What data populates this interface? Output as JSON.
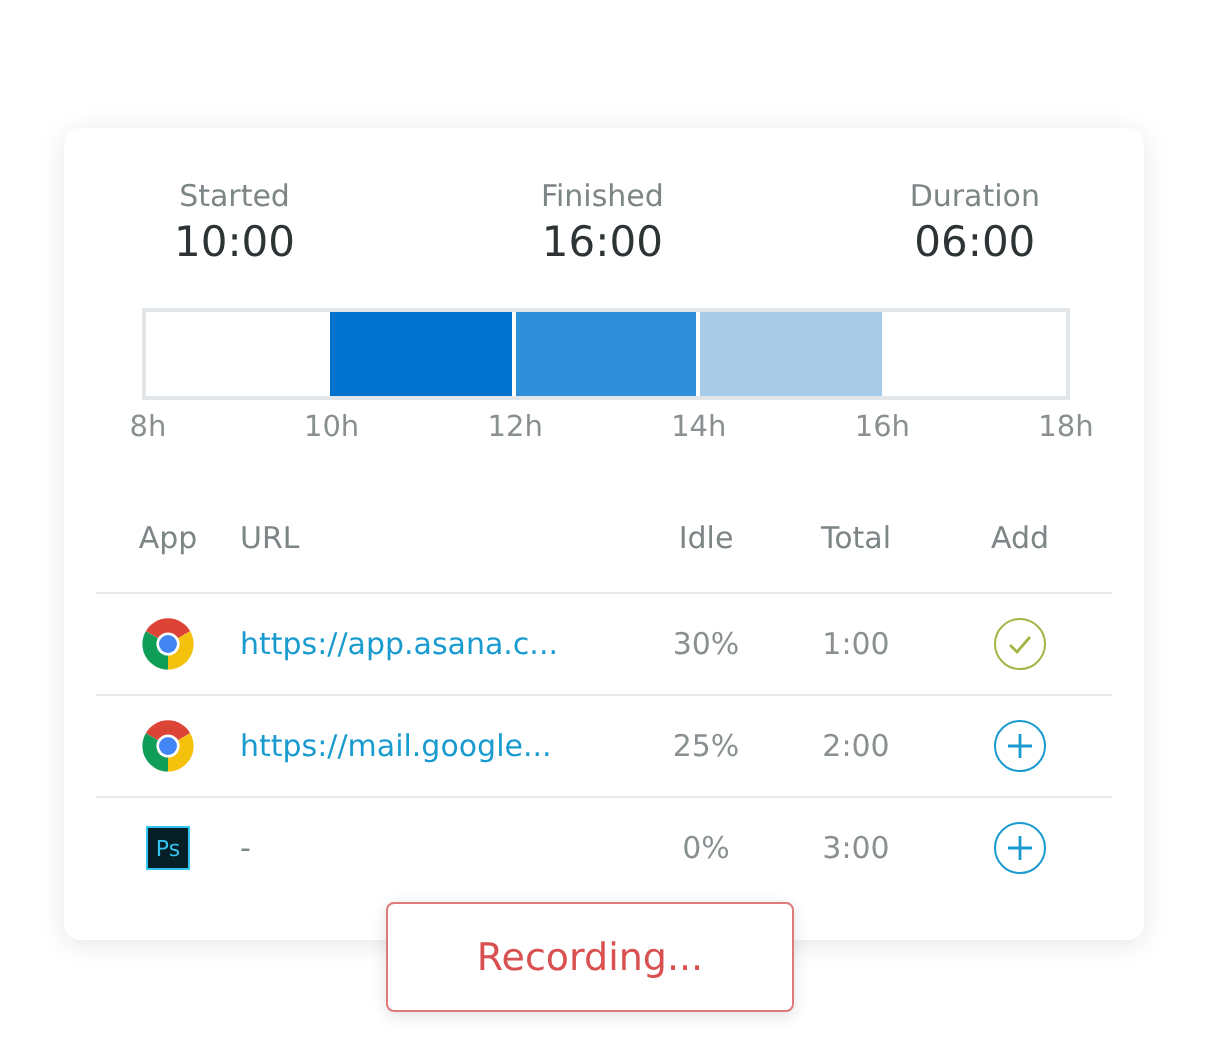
{
  "summary": [
    {
      "label": "Started",
      "value": "10:00"
    },
    {
      "label": "Finished",
      "value": "16:00"
    },
    {
      "label": "Duration",
      "value": "06:00"
    }
  ],
  "timeline": {
    "segments": [
      {
        "kind": "empty"
      },
      {
        "kind": "filled",
        "color": "#0073cf"
      },
      {
        "kind": "filled",
        "color": "#2f8fd8"
      },
      {
        "kind": "filled",
        "color": "#a8cbe8"
      },
      {
        "kind": "empty"
      }
    ],
    "ticks": [
      "8h",
      "10h",
      "12h",
      "14h",
      "16h",
      "18h"
    ]
  },
  "table": {
    "columns": [
      "App",
      "URL",
      "Idle",
      "Total",
      "Add"
    ],
    "rows": [
      {
        "kind": "browser",
        "url": "https://app.asana.c...",
        "idle": "30%",
        "total": "1:00",
        "added": true
      },
      {
        "kind": "browser",
        "url": "https://mail.google...",
        "idle": "25%",
        "total": "2:00",
        "added": false
      },
      {
        "kind": "editor",
        "logo_text": "Ps",
        "url": "-",
        "idle": "0%",
        "total": "3:00",
        "added": false
      }
    ]
  },
  "recording": {
    "label": "Recording..."
  }
}
